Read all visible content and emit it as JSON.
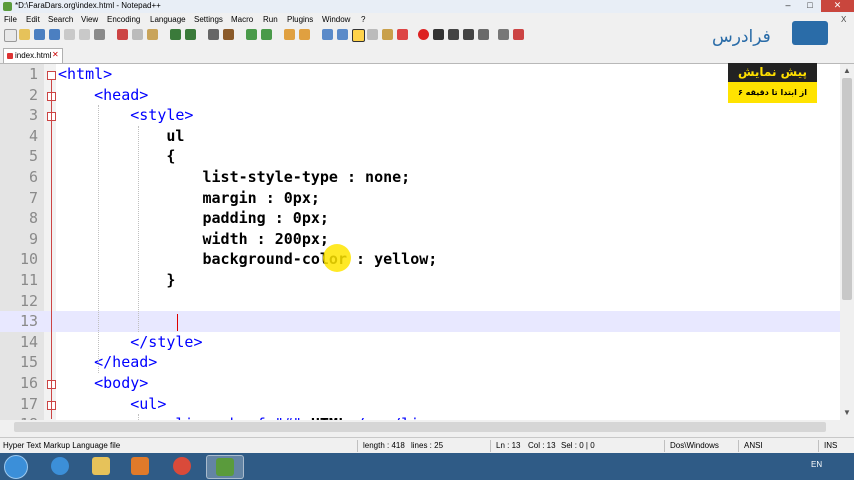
{
  "window": {
    "title": "*D:\\FaraDars.org\\index.html - Notepad++",
    "min": "–",
    "max": "□",
    "close": "✕"
  },
  "menu": [
    "File",
    "Edit",
    "Search",
    "View",
    "Encoding",
    "Language",
    "Settings",
    "Macro",
    "Run",
    "Plugins",
    "Window",
    "?"
  ],
  "menu_close": "X",
  "tab": {
    "label": "index.html",
    "close": "✕"
  },
  "lines": [
    {
      "n": "1",
      "segs": [
        {
          "t": "<html>",
          "c": "tag"
        }
      ]
    },
    {
      "n": "2",
      "segs": [
        {
          "t": "    "
        },
        {
          "t": "<head>",
          "c": "tag"
        }
      ]
    },
    {
      "n": "3",
      "segs": [
        {
          "t": "        "
        },
        {
          "t": "<style>",
          "c": "tag"
        }
      ]
    },
    {
      "n": "4",
      "segs": [
        {
          "t": "            ul",
          "c": "plain"
        }
      ]
    },
    {
      "n": "5",
      "segs": [
        {
          "t": "            {",
          "c": "plain"
        }
      ]
    },
    {
      "n": "6",
      "segs": [
        {
          "t": "                list-style-type : none;",
          "c": "plain"
        }
      ]
    },
    {
      "n": "7",
      "segs": [
        {
          "t": "                margin : 0px;",
          "c": "plain"
        }
      ]
    },
    {
      "n": "8",
      "segs": [
        {
          "t": "                padding : 0px;",
          "c": "plain"
        }
      ]
    },
    {
      "n": "9",
      "segs": [
        {
          "t": "                width : 200px;",
          "c": "plain"
        }
      ]
    },
    {
      "n": "10",
      "segs": [
        {
          "t": "                background-color : yellow;",
          "c": "plain"
        }
      ]
    },
    {
      "n": "11",
      "segs": [
        {
          "t": "            }",
          "c": "plain"
        }
      ]
    },
    {
      "n": "12",
      "segs": []
    },
    {
      "n": "13",
      "segs": []
    },
    {
      "n": "14",
      "segs": [
        {
          "t": "        "
        },
        {
          "t": "</style>",
          "c": "tag"
        }
      ]
    },
    {
      "n": "15",
      "segs": [
        {
          "t": "    "
        },
        {
          "t": "</head>",
          "c": "tag"
        }
      ]
    },
    {
      "n": "16",
      "segs": [
        {
          "t": "    "
        },
        {
          "t": "<body>",
          "c": "tag"
        }
      ]
    },
    {
      "n": "17",
      "segs": [
        {
          "t": "        "
        },
        {
          "t": "<ul>",
          "c": "tag"
        }
      ]
    },
    {
      "n": "18",
      "segs": [
        {
          "t": "            "
        },
        {
          "t": "<li><a href=\"#\">",
          "c": "tag"
        },
        {
          "t": "HTML",
          "c": "plain"
        },
        {
          "t": "</a></li>",
          "c": "tag"
        }
      ]
    }
  ],
  "current_line": "13",
  "status": {
    "file_type": "Hyper Text Markup Language file",
    "length": "length : 418",
    "lines": "lines : 25",
    "ln": "Ln : 13",
    "col": "Col : 13",
    "sel": "Sel : 0 | 0",
    "eol": "Dos\\Windows",
    "encoding": "ANSI",
    "mode": "INS"
  },
  "logo": {
    "text": "فرادرس"
  },
  "preview": {
    "title": "پیش نمایش",
    "subtitle": "از ابتدا تا دقیقه ۶"
  },
  "taskbar": {
    "lang": "EN"
  },
  "colors": {
    "accent": "#2a6ca8",
    "highlight": "#ffe500",
    "tag": "#0000ff"
  }
}
